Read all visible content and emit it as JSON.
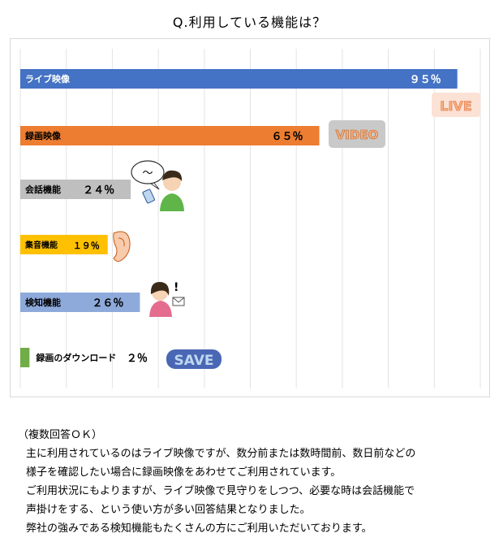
{
  "chart_data": {
    "type": "bar",
    "orientation": "horizontal",
    "title": "Q.利用している機能は？",
    "categories": [
      "ライブ映像",
      "録画映像",
      "会話機能",
      "集音機能",
      "検知機能",
      "録画のダウンロード"
    ],
    "values": [
      95,
      65,
      24,
      19,
      26,
      2
    ],
    "value_labels": [
      "９５％",
      "６５％",
      "２４％",
      "１９％",
      "２６％",
      "２％"
    ],
    "colors": [
      "#4472c4",
      "#ed7d31",
      "#bfbfbf",
      "#ffc000",
      "#8eaadb",
      "#70ad47"
    ],
    "xlim": [
      0,
      100
    ],
    "grid": true,
    "legend": "none"
  },
  "badges": {
    "live": "LIVE",
    "video": "VIDEO",
    "save": "SAVE",
    "speech": "～",
    "exclaim": "!"
  },
  "note": {
    "lines": [
      "（複数回答ＯＫ）",
      "主に利用されているのはライブ映像ですが、数分前または数時間前、数日前などの",
      "様子を確認したい場合に録画映像をあわせてご利用されています。",
      "ご利用状況にもよりますが、ライブ映像で見守りをしつつ、必要な時は会話機能で",
      "声掛けをする、という使い方が多い回答結果となりました。",
      "弊社の強みである検知機能もたくさんの方にご利用いただいております。"
    ]
  }
}
